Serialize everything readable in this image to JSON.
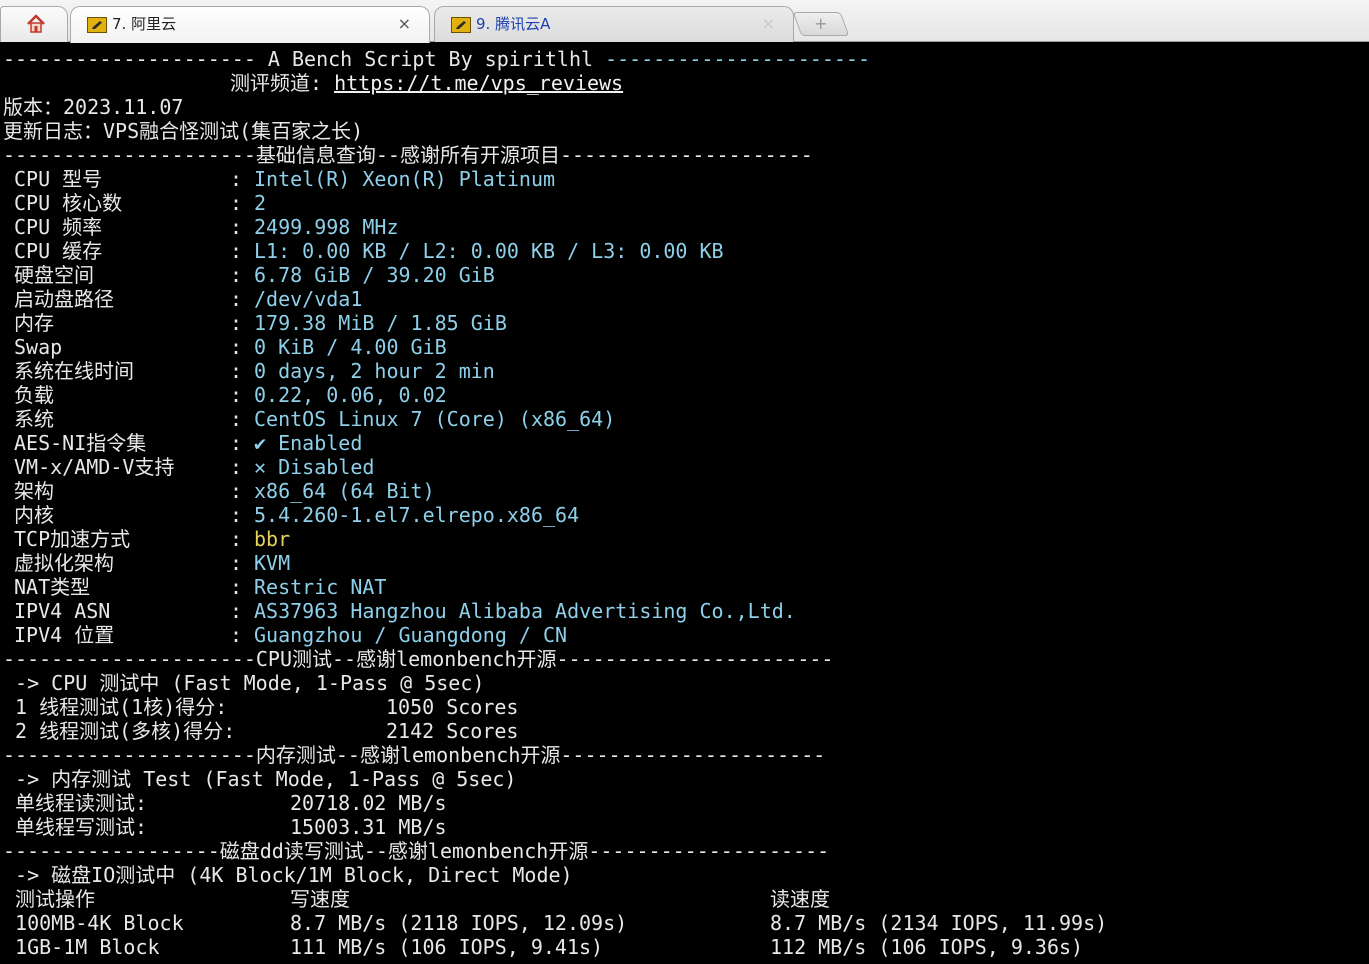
{
  "tabs": {
    "home_icon": "home-icon",
    "active": {
      "label": "7. 阿里云",
      "close": "×",
      "icon": "ssh-key-icon"
    },
    "inactive": {
      "label": "9. 腾讯云A",
      "close": "×",
      "icon": "ssh-key-icon"
    },
    "new_tab": "+"
  },
  "colors": {
    "background": "#000000",
    "text": "#e8e8e8",
    "value": "#8ed0ea",
    "highlight": "#e5d160"
  },
  "header": {
    "title_left_dashes": "---------------------",
    "title": " A Bench Script By spiritlhl ",
    "title_right_dashes": "----------------------",
    "channel_label": "测评频道: ",
    "channel_url": "https://t.me/vps_reviews",
    "version_label": "版本：",
    "version": "2023.11.07",
    "changelog_label": "更新日志：",
    "changelog": "VPS融合怪测试(集百家之长)"
  },
  "sections": {
    "basic": {
      "left": "---------------------",
      "title": "基础信息查询--感谢所有开源项目",
      "right": "---------------------"
    },
    "cpu": {
      "left": "---------------------",
      "title": "CPU测试--感谢lemonbench开源",
      "right": "-----------------------"
    },
    "memory": {
      "left": "---------------------",
      "title": "内存测试--感谢lemonbench开源",
      "right": "----------------------"
    },
    "disk": {
      "left": "------------------",
      "title": "磁盘dd读写测试--感谢lemonbench开源",
      "right": "--------------------"
    }
  },
  "sysinfo": [
    {
      "label": "CPU 型号",
      "value": "Intel(R) Xeon(R) Platinum"
    },
    {
      "label": "CPU 核心数",
      "value": "2"
    },
    {
      "label": "CPU 频率",
      "value": "2499.998 MHz"
    },
    {
      "label": "CPU 缓存",
      "value": "L1: 0.00 KB / L2: 0.00 KB / L3: 0.00 KB"
    },
    {
      "label": "硬盘空间",
      "value": "6.78 GiB / 39.20 GiB"
    },
    {
      "label": "启动盘路径",
      "value": "/dev/vda1"
    },
    {
      "label": "内存",
      "value": "179.38 MiB / 1.85 GiB"
    },
    {
      "label": "Swap",
      "value": "0 KiB / 4.00 GiB"
    },
    {
      "label": "系统在线时间",
      "value": "0 days, 2 hour 2 min"
    },
    {
      "label": "负载",
      "value": "0.22, 0.06, 0.02"
    },
    {
      "label": "系统",
      "value": "CentOS Linux 7 (Core) (x86_64)"
    },
    {
      "label": "AES-NI指令集",
      "value": "✔ Enabled"
    },
    {
      "label": "VM-x/AMD-V支持",
      "value": "✕ Disabled"
    },
    {
      "label": "架构",
      "value": "x86_64 (64 Bit)"
    },
    {
      "label": "内核",
      "value": "5.4.260-1.el7.elrepo.x86_64"
    },
    {
      "label": "TCP加速方式",
      "value": "bbr"
    },
    {
      "label": "虚拟化架构",
      "value": "KVM"
    },
    {
      "label": "NAT类型",
      "value": "Restric NAT"
    },
    {
      "label": "IPV4 ASN",
      "value": "AS37963 Hangzhou Alibaba Advertising Co.,Ltd."
    },
    {
      "label": "IPV4 位置",
      "value": "Guangzhou / Guangdong / CN"
    }
  ],
  "separator": ": ",
  "cpu_test": {
    "mode": " -> CPU 测试中 (Fast Mode, 1-Pass @ 5sec)",
    "rows": [
      {
        "label": " 1 线程测试(1核)得分:",
        "value": "1050 Scores"
      },
      {
        "label": " 2 线程测试(多核)得分:",
        "value": "2142 Scores"
      }
    ]
  },
  "memory_test": {
    "mode": " -> 内存测试 Test (Fast Mode, 1-Pass @ 5sec)",
    "rows": [
      {
        "label": " 单线程读测试:",
        "value": "20718.02 MB/s"
      },
      {
        "label": " 单线程写测试:",
        "value": "15003.31 MB/s"
      }
    ]
  },
  "disk_test": {
    "mode": " -> 磁盘IO测试中 (4K Block/1M Block, Direct Mode)",
    "headers": {
      "op": " 测试操作",
      "write": "写速度",
      "read": "读速度"
    },
    "rows": [
      {
        "op": " 100MB-4K Block",
        "write": "8.7 MB/s (2118 IOPS, 12.09s)",
        "read": "8.7 MB/s (2134 IOPS, 11.99s)"
      },
      {
        "op": " 1GB-1M Block",
        "write": "111 MB/s (106 IOPS, 9.41s)",
        "read": "112 MB/s (106 IOPS, 9.36s)"
      }
    ]
  }
}
